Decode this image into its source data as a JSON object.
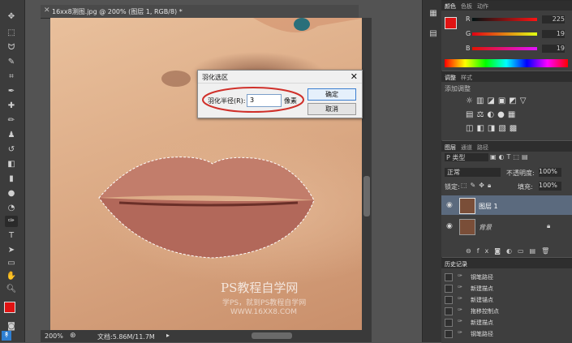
{
  "document": {
    "tab_title": "16xx8测图.jpg @ 200% (图层 1, RGB/8) *",
    "zoom": "200%",
    "doc_size": "文档:5.86M/11.7M",
    "watermark_line1": "PS教程自学网",
    "watermark_line2": "学PS，就到PS教程自学网",
    "watermark_line3": "WWW.16XX8.COM"
  },
  "dialog": {
    "title": "羽化选区",
    "close_glyph": "✕",
    "radius_label": "羽化半径(R):",
    "radius_value": "3",
    "unit": "像素",
    "ok_label": "确定",
    "cancel_label": "取消"
  },
  "color_panel": {
    "tabs": [
      "颜色",
      "色板",
      "动作"
    ],
    "r": "R",
    "g": "G",
    "b": "B",
    "r_val": "225",
    "g_val": "19",
    "b_val": "19",
    "foreground": "#e01313"
  },
  "adjust_panel": {
    "tabs": [
      "调整",
      "样式"
    ],
    "header": "添加调整"
  },
  "layers_panel": {
    "tabs": [
      "图层",
      "通道",
      "路径"
    ],
    "filter": "P 类型",
    "blend_mode": "正常",
    "opacity_label": "不透明度:",
    "opacity_value": "100%",
    "lock_label": "锁定:",
    "fill_label": "填充:",
    "fill_value": "100%",
    "layers": [
      {
        "name": "图层 1",
        "selected": true
      },
      {
        "name": "背景",
        "selected": false
      }
    ]
  },
  "history_panel": {
    "tab": "历史记录",
    "items": [
      "钢笔路径",
      "新建描点",
      "新建锚点",
      "拖移控制点",
      "新建描点",
      "钢笔路径"
    ]
  },
  "colors": {
    "foreground": "#e01313",
    "background": "#000000",
    "accent": "#3c7fd0",
    "ellipse": "#d0302a"
  }
}
